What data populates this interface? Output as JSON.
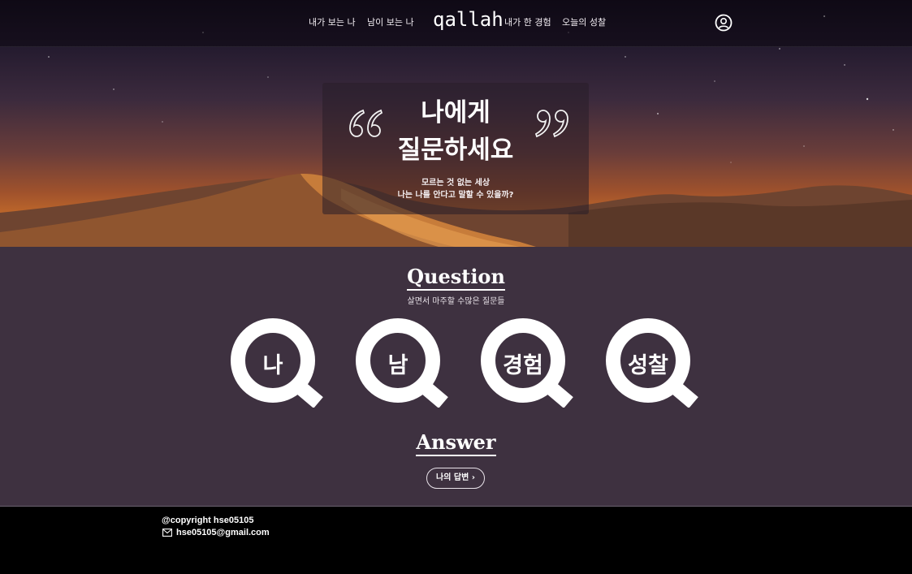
{
  "header": {
    "nav_left": [
      "내가 보는 나",
      "남이 보는 나"
    ],
    "logo": "qallah",
    "nav_right": [
      "내가 한 경험",
      "오늘의 성찰"
    ],
    "user_icon": "user-circle-icon"
  },
  "hero": {
    "title_line1": "나에게",
    "title_line2": "질문하세요",
    "subtitle_line1": "모르는 것 없는 세상",
    "subtitle_line2": "나는 나를 안다고 말할 수 있을까?"
  },
  "question_section": {
    "title": "Question",
    "subtitle": "살면서 마주할 수많은 질문들",
    "items": [
      "나",
      "남",
      "경험",
      "성찰"
    ]
  },
  "answer_section": {
    "title": "Answer",
    "button_label": "나의 답변",
    "button_icon": "chevron-right-icon"
  },
  "footer": {
    "copyright": "@copyright hse05105",
    "email": "hse05105@gmail.com",
    "email_icon": "mail-icon"
  },
  "colors": {
    "main_bg": "#3e3140",
    "footer_bg": "#000000",
    "accent_white": "#ffffff"
  }
}
